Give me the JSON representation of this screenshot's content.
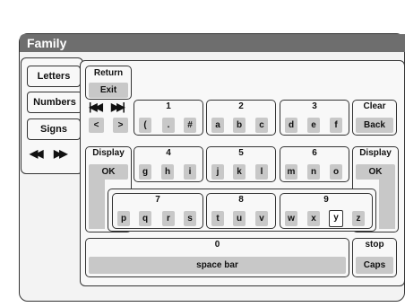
{
  "window": {
    "title": "Family"
  },
  "tabs": [
    {
      "label": "Letters"
    },
    {
      "label": "Numbers"
    },
    {
      "label": "Signs"
    }
  ],
  "tab_nav": {
    "prev_icon": "double-left-arrow-icon",
    "next_icon": "double-right-arrow-icon"
  },
  "controls": {
    "return_label": "Return",
    "exit_label": "Exit",
    "skip_back_icon": "skip-back-icon",
    "skip_forward_icon": "skip-forward-icon",
    "cursor_left": "<",
    "cursor_right": ">",
    "clear_label": "Clear",
    "back_label": "Back",
    "display_label": "Display",
    "ok_label": "OK",
    "display_right_label": "Display",
    "ok_right_label": "OK",
    "stop_label": "stop",
    "caps_label": "Caps"
  },
  "key_groups": [
    {
      "number": "1",
      "keys": [
        "(",
        ".",
        "#"
      ]
    },
    {
      "number": "2",
      "keys": [
        "a",
        "b",
        "c"
      ]
    },
    {
      "number": "3",
      "keys": [
        "d",
        "e",
        "f"
      ]
    },
    {
      "number": "4",
      "keys": [
        "g",
        "h",
        "i"
      ]
    },
    {
      "number": "5",
      "keys": [
        "j",
        "k",
        "l"
      ]
    },
    {
      "number": "6",
      "keys": [
        "m",
        "n",
        "o"
      ]
    },
    {
      "number": "7",
      "keys": [
        "p",
        "q",
        "r",
        "s"
      ]
    },
    {
      "number": "8",
      "keys": [
        "t",
        "u",
        "v"
      ]
    },
    {
      "number": "9",
      "keys": [
        "w",
        "x",
        "y",
        "z"
      ]
    },
    {
      "number": "0",
      "keys": [
        "space bar"
      ]
    }
  ],
  "selected_key": "y"
}
